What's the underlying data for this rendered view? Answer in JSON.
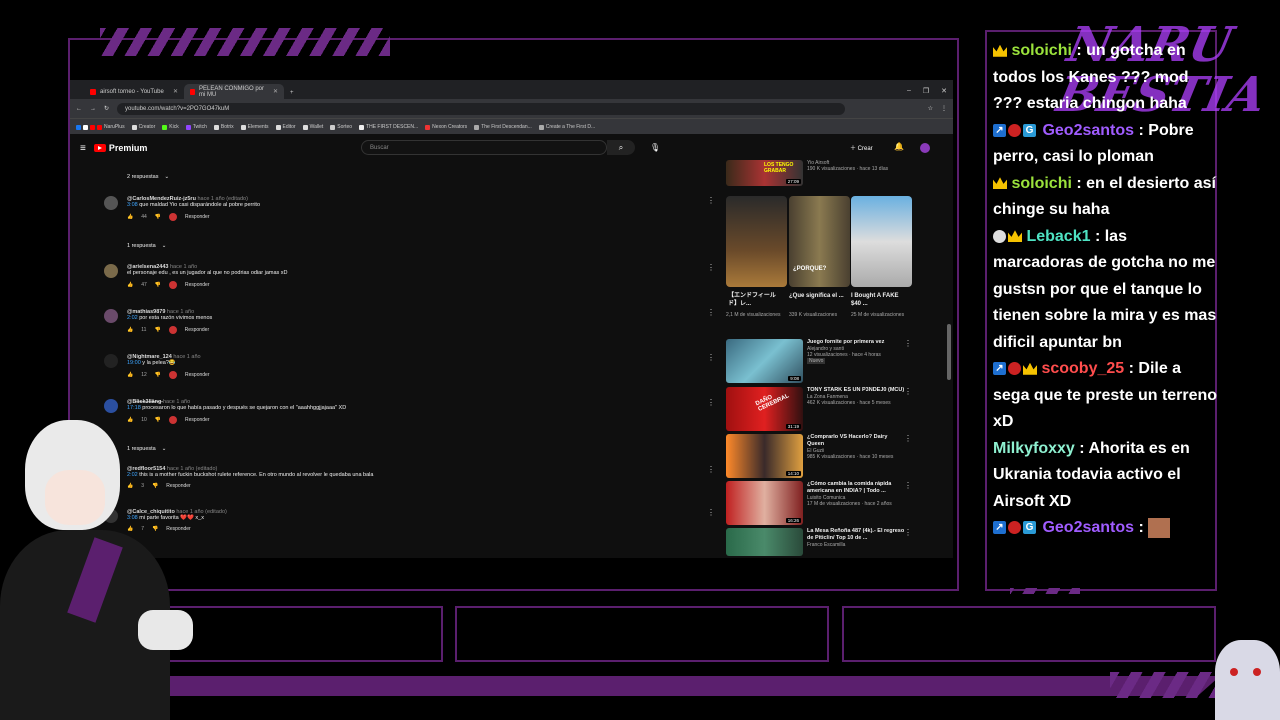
{
  "browser": {
    "tabs": [
      {
        "label": "airsoft torneo - YouTube",
        "active": false
      },
      {
        "label": "PELEAN CONMIGO por mi MU",
        "active": true
      }
    ],
    "new_tab": "+",
    "window_controls": [
      "–",
      "❐",
      "✕"
    ],
    "url": "youtube.com/watch?v=2PO7GO47kuM",
    "bookmarks": [
      "NaruPlus",
      "Creator",
      "Kick",
      "Twitch",
      "Botrix",
      "Elements",
      "Editor",
      "Wallet",
      "Sorteo",
      "THE FIRST DESCEN...",
      "Nexon Creators",
      "The First Descendan...",
      "Create a The First D..."
    ]
  },
  "youtube": {
    "logo": "Premium",
    "search_placeholder": "Buscar",
    "create_label": "Crear",
    "comments": [
      {
        "author": "@CarlosMendezRuiz-jz5ru",
        "meta": "hace 1 año (editado)",
        "ts": "3:08",
        "text": " que maldad Yio casi disparándole  al pobre perrito",
        "likes": "44",
        "reply": "Responder",
        "replies": "1 respuesta"
      },
      {
        "author": "@arielsena2443",
        "meta": "hace 1 año",
        "ts": "",
        "text": "el personaje edu , es un jugador al que no podrias odiar jamas xD",
        "likes": "47",
        "reply": "Responder",
        "replies": ""
      },
      {
        "author": "@mathias9879",
        "meta": "hace 1 año",
        "ts": "2:02",
        "text": " por esta razón vivimos menos",
        "likes": "11",
        "reply": "Responder",
        "replies": ""
      },
      {
        "author": "@Nightmare_124",
        "meta": "hace 1 año",
        "ts": "19:00",
        "text": " y la pelea?😂",
        "likes": "12",
        "reply": "Responder",
        "replies": ""
      },
      {
        "author": "@B̶l̶i̶s̶k̶3̶l̶l̶ä̶n̶g̶",
        "meta": "hace 1 año",
        "ts": "17:18",
        "text": " procesaron lo que había pasado y después se quejaron con el \"aaahhggjjajaaa\" XD",
        "likes": "10",
        "reply": "Responder",
        "replies": "1 respuesta"
      },
      {
        "author": "@redfloor5154",
        "meta": "hace 1 año (editado)",
        "ts": "2:02",
        "text": " this is a mother fuckin buckshot rulete reference. En otro mundo al revolver le quedaba una bala",
        "likes": "3",
        "reply": "Responder",
        "replies": ""
      },
      {
        "author": "@Calce_chiquitito",
        "meta": "hace 1 año (editado)",
        "ts": "3:08",
        "text": " mi parte favorita ❤️❤️ x_x",
        "likes": "7",
        "reply": "Responder",
        "replies": ""
      }
    ],
    "top_replies": "2 respuestas",
    "top_video": {
      "channel": "Yio Airsoft",
      "views": "190 K visualizaciones · hace 13 días",
      "thumb_text": "LOS TENGO GRABAR",
      "duration": "27:09"
    },
    "shorts": [
      {
        "title": "【エンドフィールド】レ...",
        "views": "2,1 M de visualizaciones"
      },
      {
        "title": "¿Que significa el ...",
        "views": "339 K visualizaciones",
        "thumb_text": "¿PORQUE?"
      },
      {
        "title": "I Bought A FAKE $40 ...",
        "views": "25 M de visualizaciones"
      }
    ],
    "videos": [
      {
        "title": "Juego fornite por primera vez",
        "channel": "Alejandro y santi",
        "views": "12 visualizaciones · hace 4 horas",
        "badge": "Nuevo",
        "duration": "9:08"
      },
      {
        "title": "TONY STARK ES UN P3NDEJ0 (MCU)",
        "channel": "La Zona Fanmena",
        "views": "462 K visualizaciones · hace 5 meses",
        "duration": "31:19",
        "thumb_text": "DAÑO CEREBRAL"
      },
      {
        "title": "¿Comprarlo VS Hacerlo? Dairy Queen",
        "channel": "El Guzii",
        "views": "985 K visualizaciones · hace 10 meses",
        "duration": "14:10"
      },
      {
        "title": "¿Cómo cambia la comida rápida americana en INDIA? | Todo ...",
        "channel": "Luisito Comunica",
        "views": "17 M de visualizaciones · hace 2 años",
        "duration": "16:26"
      },
      {
        "title": "La Mesa Reñoña 487 (4k).- El regreso de Piticlin/ Top 10 de ...",
        "channel": "Franco Escamilla",
        "views": "",
        "duration": ""
      }
    ]
  },
  "chat": [
    {
      "badges": [
        "crown"
      ],
      "user": "soloichi",
      "user_color": "#9be23c",
      "text": " : un gotcha en todos los Kanes ??? mod ??? estaria chingon haha"
    },
    {
      "badges": [
        "prime",
        "red",
        "gg"
      ],
      "user": "Geo2santos",
      "user_color": "#a05cff",
      "text": " : Pobre perro, casi lo ploman"
    },
    {
      "badges": [
        "crown"
      ],
      "user": "soloichi",
      "user_color": "#9be23c",
      "text": " : en el desierto así chinge su haha"
    },
    {
      "badges": [
        "white",
        "crown"
      ],
      "user": "Leback1",
      "user_color": "#4fe3c3",
      "text": " : las marcadoras de gotcha no me gustsn por que el tanque lo tienen sobre la mira y es mas dificil apuntar bn"
    },
    {
      "badges": [
        "prime",
        "red",
        "crown"
      ],
      "user": "scooby_25",
      "user_color": "#ff4d4d",
      "text": " : Dile a sega que te preste un terreno xD"
    },
    {
      "badges": [],
      "user": "Milkyfoxxy",
      "user_color": "#8ef0d0",
      "text": " : Ahorita es en Ukrania todavia activo el Airsoft XD"
    },
    {
      "badges": [
        "prime",
        "red",
        "gg"
      ],
      "user": "Geo2santos",
      "user_color": "#a05cff",
      "text": " : "
    }
  ],
  "overlay": {
    "logo_text": "NARU BESTIA"
  }
}
